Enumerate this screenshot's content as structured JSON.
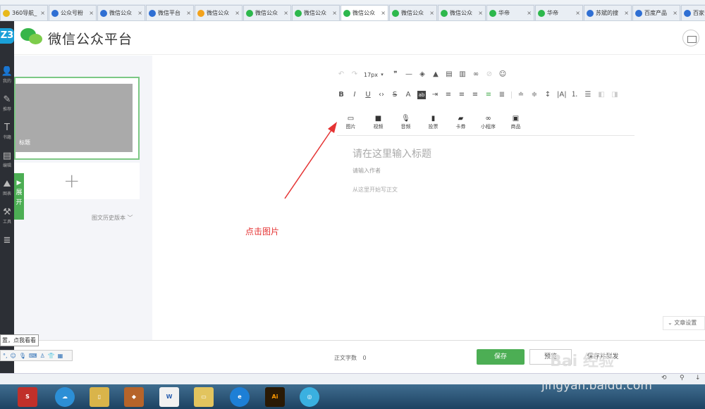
{
  "browser": {
    "tabs": [
      {
        "label": "360导航_",
        "color": "#e8b91a",
        "active": false
      },
      {
        "label": "公众号粉",
        "color": "#2f6fd3",
        "active": false
      },
      {
        "label": "微信公众",
        "color": "#2f6fd3",
        "active": false
      },
      {
        "label": "微信平台",
        "color": "#2f6fd3",
        "active": false
      },
      {
        "label": "微信公众",
        "color": "#f3a21b",
        "active": false
      },
      {
        "label": "微信公众",
        "color": "#2db84c",
        "active": false
      },
      {
        "label": "微信公众",
        "color": "#2db84c",
        "active": false
      },
      {
        "label": "微信公众",
        "color": "#2db84c",
        "active": true
      },
      {
        "label": "微信公众",
        "color": "#2db84c",
        "active": false
      },
      {
        "label": "微信公众",
        "color": "#2db84c",
        "active": false
      },
      {
        "label": "华帝",
        "color": "#2db84c",
        "active": false
      },
      {
        "label": "华帝",
        "color": "#2db84c",
        "active": false
      },
      {
        "label": "苏斌的搜",
        "color": "#2f6fd3",
        "active": false
      },
      {
        "label": "百度产品",
        "color": "#2f6fd3",
        "active": false
      },
      {
        "label": "百家号",
        "color": "#2f6fd3",
        "active": false
      }
    ],
    "tab_close": "×"
  },
  "sidebar": {
    "logo": "Z3",
    "items": [
      {
        "icon": "person-icon",
        "label": "我的"
      },
      {
        "icon": "wrench-icon",
        "label": "推荐"
      },
      {
        "icon": "text-icon",
        "label": "书籍"
      },
      {
        "icon": "doc-icon",
        "label": "编辑"
      },
      {
        "icon": "mountain-icon",
        "label": "图表"
      },
      {
        "icon": "hammer-icon",
        "label": "工具"
      },
      {
        "icon": "stack-icon",
        "label": ""
      }
    ]
  },
  "header": {
    "title": "微信公众平台"
  },
  "article_list": {
    "card_title": "标题",
    "add_symbol": "+",
    "expand_label": "展开",
    "history_label": "图文历史版本"
  },
  "toolbar": {
    "font_size": "17px",
    "insert_items": [
      {
        "icon": "image-icon",
        "label": "图片"
      },
      {
        "icon": "video-icon",
        "label": "视频"
      },
      {
        "icon": "mic-icon",
        "label": "音频"
      },
      {
        "icon": "vote-icon",
        "label": "投票"
      },
      {
        "icon": "card-icon",
        "label": "卡券"
      },
      {
        "icon": "miniprogram-icon",
        "label": "小程序"
      },
      {
        "icon": "goods-icon",
        "label": "商品"
      }
    ]
  },
  "editor": {
    "title_placeholder": "请在这里输入标题",
    "author_placeholder": "请输入作者",
    "body_placeholder": "从这里开始写正文",
    "annotation": "点击图片",
    "article_settings": "文章设置"
  },
  "footer": {
    "word_count_label": "正文字数",
    "word_count": "0",
    "save_label": "保存",
    "preview_label": "预览",
    "publish_label": "保存并群发"
  },
  "ime": {
    "tip": "置，点我看看"
  },
  "watermark": {
    "brand": "Bai 经验",
    "url": "jingyan.baidu.com"
  },
  "colors": {
    "accent": "#4cae54",
    "annotation": "#e53333"
  }
}
